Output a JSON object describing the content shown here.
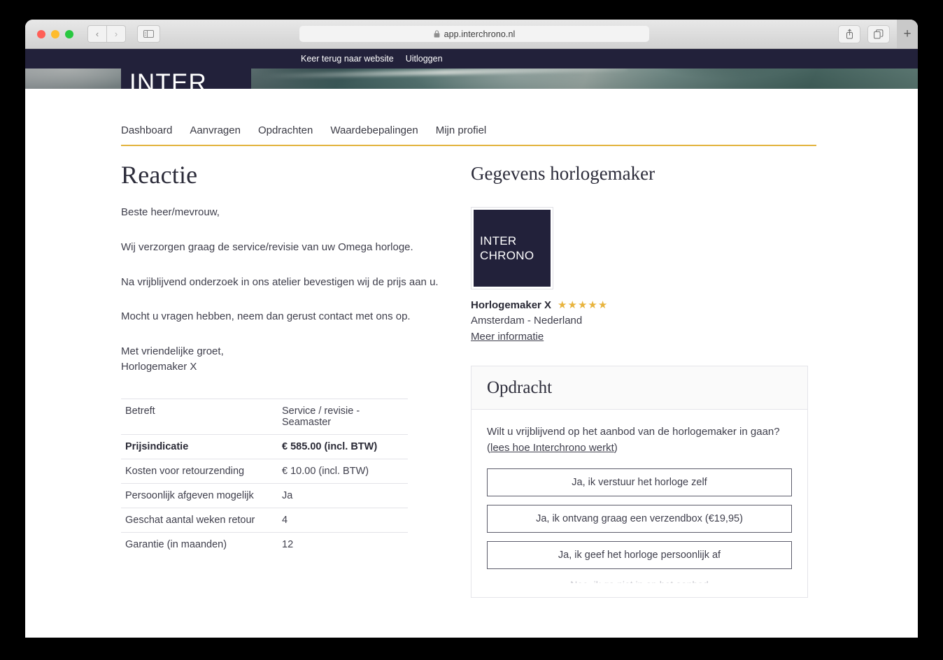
{
  "browser": {
    "url": "app.interchrono.nl",
    "lock_icon": "lock-icon",
    "back_glyph": "‹",
    "forward_glyph": "›",
    "new_tab_glyph": "+"
  },
  "topbar": {
    "back_to_site": "Keer terug naar website",
    "logout": "Uitloggen"
  },
  "logo": {
    "line1": "INTER",
    "line2": "CHRONO"
  },
  "nav": {
    "items": [
      {
        "label": "Dashboard"
      },
      {
        "label": "Aanvragen"
      },
      {
        "label": "Opdrachten"
      },
      {
        "label": "Waardebepalingen"
      },
      {
        "label": "Mijn profiel"
      }
    ]
  },
  "main": {
    "title": "Reactie",
    "letter": {
      "greeting": "Beste heer/mevrouw,",
      "paragraph1": "Wij verzorgen graag de service/revisie van uw Omega horloge.",
      "paragraph2": "Na vrijblijvend onderzoek in ons atelier bevestigen wij de prijs aan u.",
      "paragraph3": "Mocht u vragen hebben, neem dan gerust contact met ons op.",
      "closing": "Met vriendelijke groet,",
      "signature": "Horlogemaker X"
    },
    "details": {
      "rows": [
        {
          "key": "Betreft",
          "value": "Service / revisie - Seamaster",
          "strong": false
        },
        {
          "key": "Prijsindicatie",
          "value": "€ 585.00 (incl. BTW)",
          "strong": true
        },
        {
          "key": "Kosten voor retourzending",
          "value": "€ 10.00 (incl. BTW)",
          "strong": false
        },
        {
          "key": "Persoonlijk afgeven mogelijk",
          "value": "Ja",
          "strong": false
        },
        {
          "key": "Geschat aantal weken retour",
          "value": "4",
          "strong": false
        },
        {
          "key": "Garantie (in maanden)",
          "value": "12",
          "strong": false
        }
      ]
    }
  },
  "watchmaker": {
    "section_title": "Gegevens horlogemaker",
    "logo_line1": "INTER",
    "logo_line2": "CHRONO",
    "name": "Horlogemaker X",
    "rating_stars": "★★★★★",
    "rating_value": 5,
    "location": "Amsterdam - Nederland",
    "more_info": "Meer informatie"
  },
  "assignment": {
    "card_title": "Opdracht",
    "question": "Wilt u vrijblijvend op het aanbod van de horlogemaker in gaan?",
    "link_open": "(",
    "link_text": "lees hoe Interchrono werkt",
    "link_close": ")",
    "options": [
      {
        "label": "Ja, ik verstuur het horloge zelf"
      },
      {
        "label": "Ja, ik ontvang graag een verzendbox (€19,95)"
      },
      {
        "label": "Ja, ik geef het horloge persoonlijk af"
      }
    ],
    "cut_off_text": "Nee, ik ga niet in op het aanbod"
  },
  "colors": {
    "brand_dark": "#22213A",
    "accent_gold": "#E2B33E",
    "star_gold": "#E8B43D",
    "text": "#3F3F4C",
    "border": "#E4E4E9"
  }
}
